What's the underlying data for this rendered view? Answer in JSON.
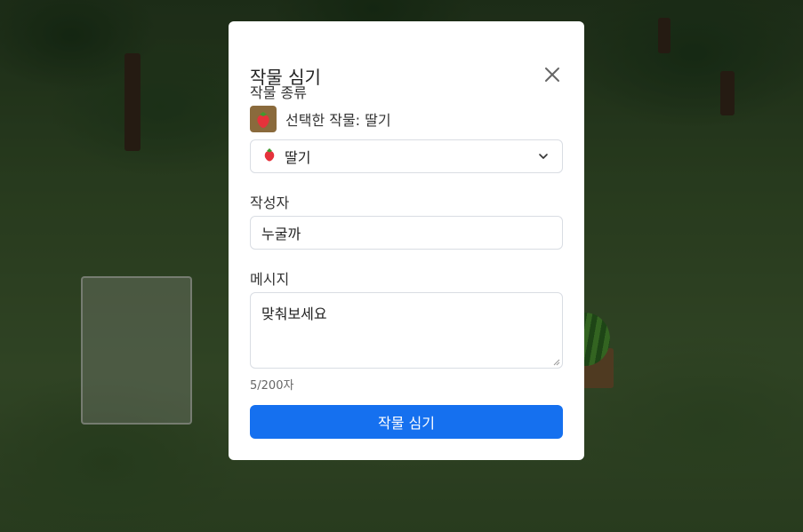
{
  "modal": {
    "title": "작물 심기",
    "crop_type_label": "작물 종류",
    "selected_text": "선택한 작물: 딸기",
    "select_value": "딸기",
    "author_label": "작성자",
    "author_value": "누굴까",
    "message_label": "메시지",
    "message_value": "맞춰보세요",
    "char_count": "5/200자",
    "submit_label": "작물 심기"
  },
  "icons": {
    "close": "close-icon",
    "crop_thumbnail": "strawberry-plot-icon",
    "select_item": "strawberry-icon",
    "dropdown": "chevron-down-icon"
  },
  "colors": {
    "primary": "#1570ef",
    "strawberry": "#e5323b"
  }
}
